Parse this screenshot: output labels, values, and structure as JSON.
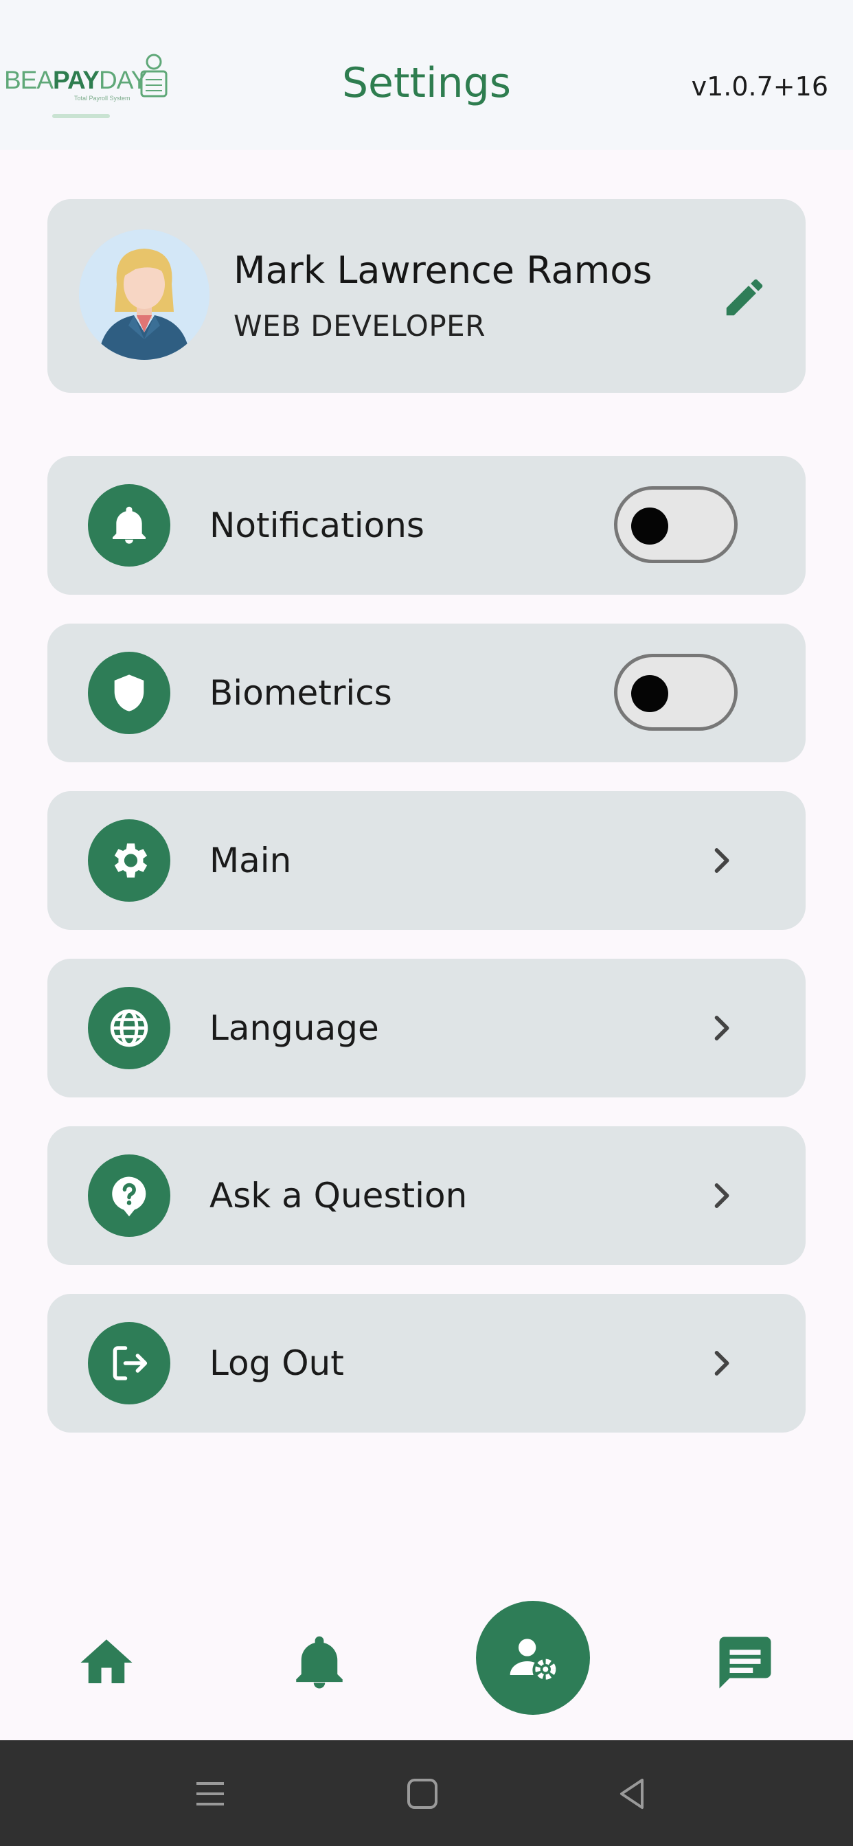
{
  "header": {
    "logo_text_light_1": "BEA",
    "logo_text_bold": "PAY",
    "logo_text_light_2": "DAY",
    "logo_subtitle": "Total Payroll System",
    "title": "Settings",
    "version": "v1.0.7+16"
  },
  "profile": {
    "name": "Mark Lawrence Ramos",
    "role": "WEB DEVELOPER",
    "edit_icon": "pencil-icon"
  },
  "settings": [
    {
      "label": "Notifications",
      "icon": "bell-icon",
      "control": "toggle",
      "enabled": false
    },
    {
      "label": "Biometrics",
      "icon": "shield-icon",
      "control": "toggle",
      "enabled": false
    },
    {
      "label": "Main",
      "icon": "gear-icon",
      "control": "chevron"
    },
    {
      "label": "Language",
      "icon": "globe-icon",
      "control": "chevron"
    },
    {
      "label": "Ask a Question",
      "icon": "help-bubble-icon",
      "control": "chevron"
    },
    {
      "label": "Log Out",
      "icon": "logout-icon",
      "control": "chevron"
    }
  ],
  "bottom_nav": [
    {
      "name": "home",
      "icon": "home-icon"
    },
    {
      "name": "notifications",
      "icon": "bell-icon"
    },
    {
      "name": "account-settings",
      "icon": "user-gear-icon",
      "active": true
    },
    {
      "name": "messages",
      "icon": "chat-icon"
    }
  ],
  "colors": {
    "primary": "#2e7d57",
    "card": "#dfe4e6",
    "background": "#fcf8fc",
    "header_bg": "#f5f7fa",
    "system_bar": "#303030"
  }
}
